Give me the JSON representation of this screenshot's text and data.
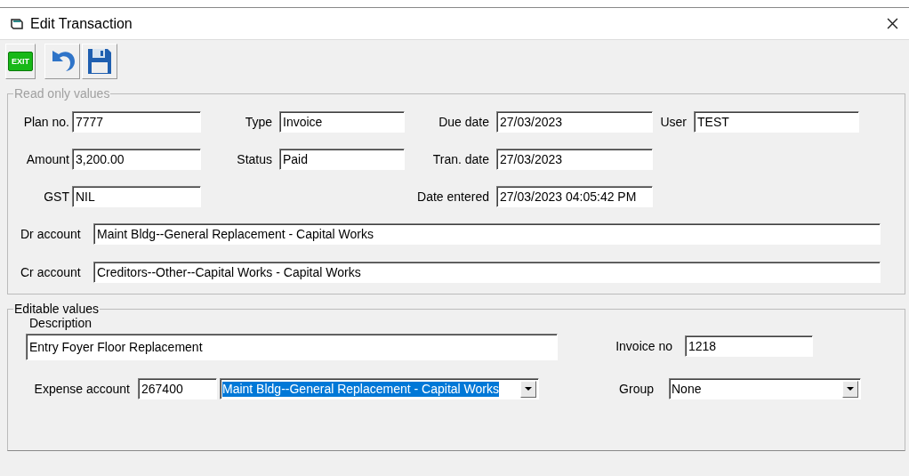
{
  "window": {
    "title": "Edit Transaction"
  },
  "toolbar": {
    "exit_label": "EXIT"
  },
  "read_only": {
    "legend": "Read only values",
    "columns": [
      [
        {
          "label": "Plan no.",
          "value": "7777"
        },
        {
          "label": "Amount",
          "value": "3,200.00"
        },
        {
          "label": "GST",
          "value": "NIL"
        }
      ],
      [
        {
          "label": "Type",
          "value": "Invoice"
        },
        {
          "label": "Status",
          "value": "Paid"
        }
      ],
      [
        {
          "label": "Due date",
          "value": "27/03/2023"
        },
        {
          "label": "Tran. date",
          "value": "27/03/2023"
        },
        {
          "label": "Date entered",
          "value": "27/03/2023 04:05:42 PM"
        }
      ],
      [
        {
          "label": "User",
          "value": "TEST"
        }
      ]
    ],
    "accounts": [
      {
        "label": "Dr account",
        "value": "Maint Bldg--General Replacement - Capital Works"
      },
      {
        "label": "Cr account",
        "value": "Creditors--Other--Capital Works - Capital Works"
      }
    ]
  },
  "editable": {
    "legend": "Editable values",
    "description": {
      "label": "Description",
      "value": "Entry Foyer Floor Replacement"
    },
    "invoice_no": {
      "label": "Invoice no",
      "value": "1218"
    },
    "expense_account": {
      "label": "Expense account",
      "code": "267400",
      "value": "Maint Bldg--General Replacement - Capital Works",
      "selected": true
    },
    "group": {
      "label": "Group",
      "value": "None"
    }
  }
}
